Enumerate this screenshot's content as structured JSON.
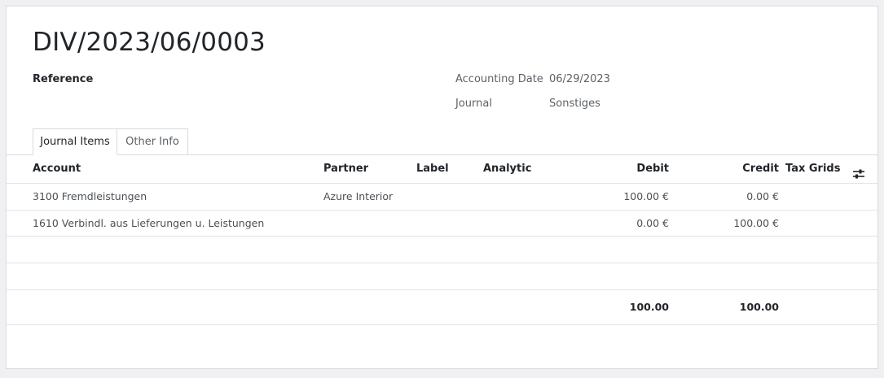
{
  "entry": {
    "title": "DIV/2023/06/0003",
    "reference_label": "Reference",
    "accounting_date_label": "Accounting Date",
    "accounting_date_value": "06/29/2023",
    "journal_label": "Journal",
    "journal_value": "Sonstiges"
  },
  "tabs": [
    {
      "label": "Journal Items",
      "active": true
    },
    {
      "label": "Other Info",
      "active": false
    }
  ],
  "table": {
    "columns": {
      "account": "Account",
      "partner": "Partner",
      "label": "Label",
      "analytic": "Analytic",
      "debit": "Debit",
      "credit": "Credit",
      "tax_grids": "Tax Grids",
      "settings_icon": "column-settings-icon"
    },
    "rows": [
      {
        "account": "3100 Fremdleistungen",
        "partner": "Azure Interior",
        "label": "",
        "analytic": "",
        "debit": "100.00 €",
        "credit": "0.00 €",
        "tax_grids": ""
      },
      {
        "account": "1610 Verbindl. aus Lieferungen u. Leistungen",
        "partner": "",
        "label": "",
        "analytic": "",
        "debit": "0.00 €",
        "credit": "100.00 €",
        "tax_grids": ""
      }
    ],
    "totals": {
      "debit": "100.00",
      "credit": "100.00"
    }
  },
  "colors": {
    "background": "#f0f0f2",
    "sheet": "#ffffff",
    "border": "#d8dadd",
    "text": "#212529",
    "muted_text": "#5c6166"
  }
}
